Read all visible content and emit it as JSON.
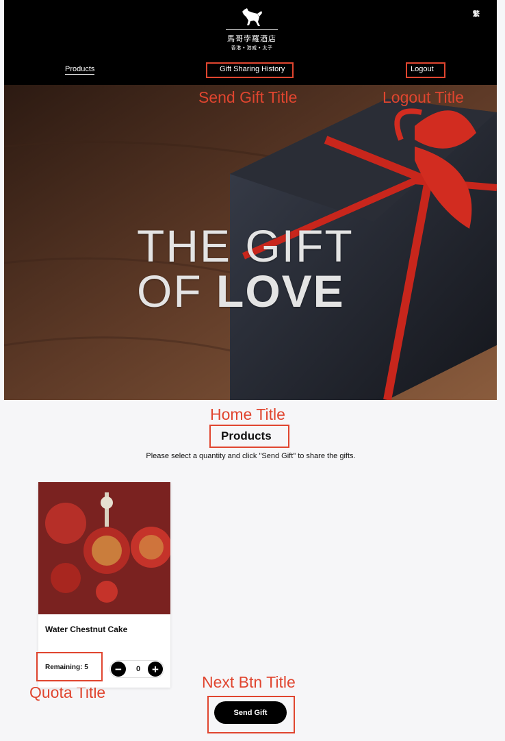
{
  "header": {
    "language_toggle": "繁",
    "logo": {
      "name_cn": "馬哥孛羅酒店",
      "locations": "香港 • 港威 • 太子"
    },
    "nav": {
      "products": "Products",
      "history": "Gift Sharing History",
      "logout": "Logout"
    }
  },
  "annotations": {
    "send_gift_title": "Send Gift Title",
    "logout_title": "Logout Title",
    "home_title": "Home Title",
    "quota_title": "Quota Title",
    "next_btn_title": "Next Btn Title"
  },
  "hero": {
    "line1": "THE GIFT",
    "line2_a": "OF ",
    "line2_b": "LOVE"
  },
  "main": {
    "section_title": "Products",
    "instruction": "Please select a quantity and click \"Send Gift\" to share the gifts.",
    "products": [
      {
        "name": "Water Chestnut Cake",
        "remaining": "Remaining: 5",
        "quantity": "0"
      }
    ],
    "send_button": "Send Gift"
  },
  "colors": {
    "accent": "#e0452f",
    "header_bg": "#000000",
    "page_bg": "#f6f6f8"
  },
  "icons": {
    "minus": "minus-icon",
    "plus": "plus-icon",
    "logo": "horse-logo-icon"
  }
}
